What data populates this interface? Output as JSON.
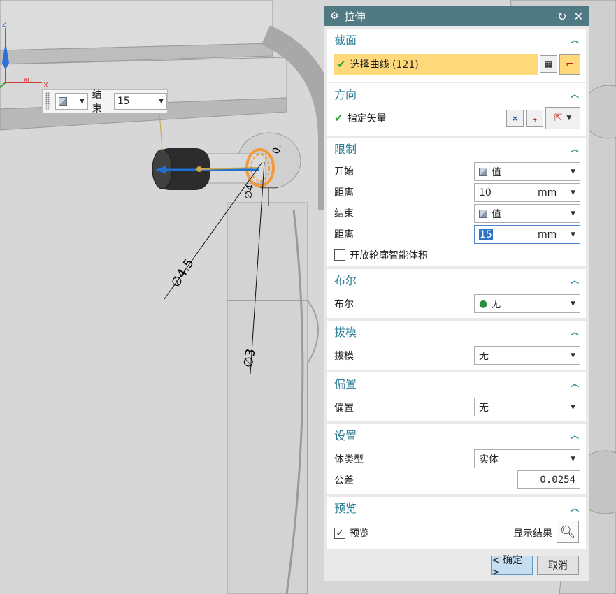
{
  "viewport": {
    "toolbar": {
      "end_label": "结束",
      "end_value": "15"
    },
    "dimensions": {
      "dia1": "∅4.5",
      "dia2": "∅3",
      "small1": "0.",
      "small2": "∅4"
    },
    "axes": {
      "x": "X",
      "xc": "XC",
      "z": "Z"
    }
  },
  "dialog": {
    "title": "拉伸",
    "section": {
      "label": "截面",
      "select_curve": "选择曲线 (121)"
    },
    "direction": {
      "label": "方向",
      "specify_vector": "指定矢量"
    },
    "limits": {
      "label": "限制",
      "start_label": "开始",
      "start_value": "值",
      "distance1_label": "距离",
      "distance1_value": "10",
      "distance1_unit": "mm",
      "end_label": "结束",
      "end_value": "值",
      "distance2_label": "距离",
      "distance2_value": "15",
      "distance2_unit": "mm",
      "open_profile": "开放轮廓智能体积"
    },
    "boolean": {
      "label": "布尔",
      "field_label": "布尔",
      "value": "无"
    },
    "draft": {
      "label": "拔模",
      "field_label": "拔模",
      "value": "无"
    },
    "offset": {
      "label": "偏置",
      "field_label": "偏置",
      "value": "无"
    },
    "settings": {
      "label": "设置",
      "body_type_label": "体类型",
      "body_type_value": "实体",
      "tolerance_label": "公差",
      "tolerance_value": "0.0254"
    },
    "preview": {
      "label": "预览",
      "preview_check": "预览",
      "show_result": "显示结果"
    },
    "ok_label": "< 确定 >",
    "cancel_label": "取消"
  },
  "colors": {
    "accent": "#2d7f96",
    "titlebar": "#4f7a84",
    "highlight": "#ffd97a",
    "check": "#2aa832",
    "orange": "#f29a3c"
  }
}
